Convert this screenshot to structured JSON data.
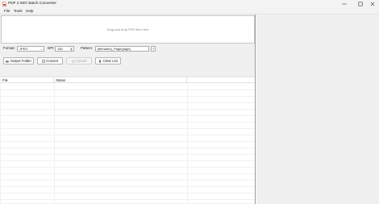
{
  "window": {
    "title": "PDF 2 IMG Batch Converter",
    "controls": {
      "minimize": "—",
      "maximize": "☐",
      "close": "✕"
    }
  },
  "menu": [
    "File",
    "Tools",
    "Help"
  ],
  "dropzone": {
    "text": "Drag and drop PDF files here"
  },
  "options": {
    "format_label": "Format:",
    "format_value": "JPEG",
    "dpi_label": "DPI:",
    "dpi_value": "150",
    "pattern_label": "Pattern:",
    "pattern_value": "{filename}_Page{page}",
    "help_label": "?"
  },
  "buttons": {
    "output_folder": {
      "label": "Output Folder",
      "icon": "folder-icon"
    },
    "convert": {
      "label": "Convert",
      "icon": "convert-icon"
    },
    "cancel": {
      "label": "Cancel",
      "icon": "cancel-icon",
      "disabled": true
    },
    "clear_list": {
      "label": "Clear List",
      "icon": "trash-icon"
    }
  },
  "table": {
    "columns": [
      "File",
      "Status"
    ],
    "rows": []
  },
  "colors": {
    "panel_bg": "#f0f0f0",
    "titlebar_bg": "#f3f3f3",
    "accent": "#c7402d"
  }
}
